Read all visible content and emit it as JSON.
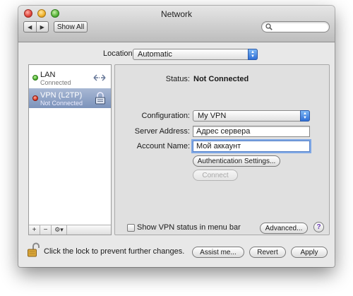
{
  "window": {
    "title": "Network"
  },
  "toolbar": {
    "back_glyph": "◀",
    "forward_glyph": "▶",
    "show_all_label": "Show All",
    "search_value": ""
  },
  "location": {
    "label": "Location:",
    "value": "Automatic"
  },
  "services": [
    {
      "name": "LAN",
      "status": "Connected",
      "status_color": "#3aa420",
      "icon": "ethernet-arrows-icon",
      "selected": false
    },
    {
      "name": "VPN (L2TP)",
      "status": "Not Connected",
      "status_color": "#d42a1a",
      "icon": "lock-icon",
      "selected": true
    }
  ],
  "sidebar_tools": {
    "add": "+",
    "remove": "−",
    "action": "⚙▾"
  },
  "detail": {
    "status_label": "Status:",
    "status_value": "Not Connected",
    "configuration_label": "Configuration:",
    "configuration_value": "My VPN",
    "server_address_label": "Server Address:",
    "server_address_value": "Адрес сервера",
    "account_name_label": "Account Name:",
    "account_name_value": "Мой аккаунт",
    "auth_settings_label": "Authentication Settings...",
    "connect_label": "Connect",
    "show_vpn_status_label": "Show VPN status in menu bar",
    "advanced_label": "Advanced...",
    "help_label": "?"
  },
  "footer": {
    "lock_text": "Click the lock to prevent further changes.",
    "assist_label": "Assist me...",
    "revert_label": "Revert",
    "apply_label": "Apply"
  }
}
